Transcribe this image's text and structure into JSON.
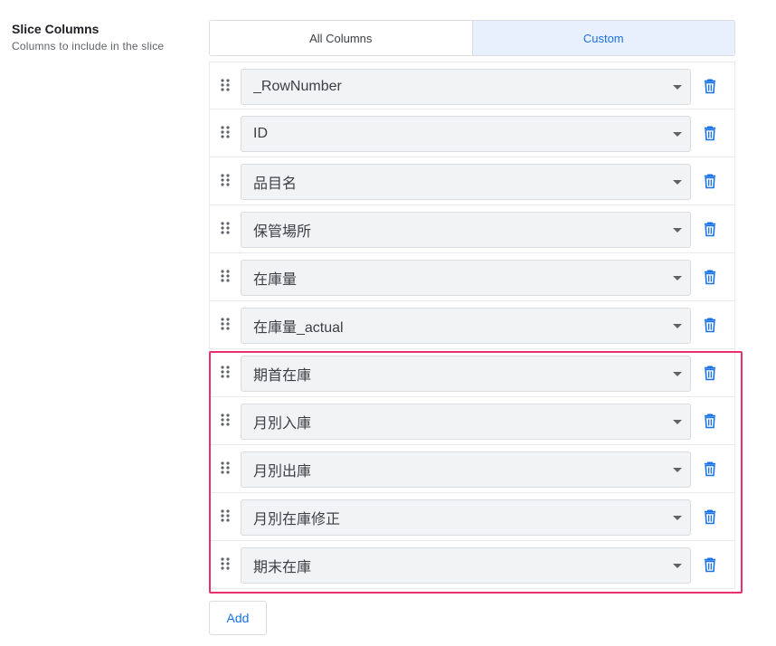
{
  "setting": {
    "title": "Slice Columns",
    "description": "Columns to include in the slice"
  },
  "mode_toggle": {
    "options": [
      "All Columns",
      "Custom"
    ],
    "selected": "Custom"
  },
  "columns": [
    {
      "value": "_RowNumber"
    },
    {
      "value": "ID"
    },
    {
      "value": "品目名"
    },
    {
      "value": "保管場所"
    },
    {
      "value": "在庫量"
    },
    {
      "value": "在庫量_actual"
    },
    {
      "value": "期首在庫"
    },
    {
      "value": "月別入庫"
    },
    {
      "value": "月別出庫"
    },
    {
      "value": "月別在庫修正"
    },
    {
      "value": "期末在庫"
    }
  ],
  "add_label": "Add",
  "icons": {
    "drag": "drag-handle-icon",
    "dropdown": "chevron-down-icon",
    "delete": "trash-icon"
  },
  "colors": {
    "accent": "#1a73e8",
    "highlight": "#e8306f",
    "select_bg": "#f1f3f4",
    "toggle_active_bg": "#e8f0fe"
  }
}
